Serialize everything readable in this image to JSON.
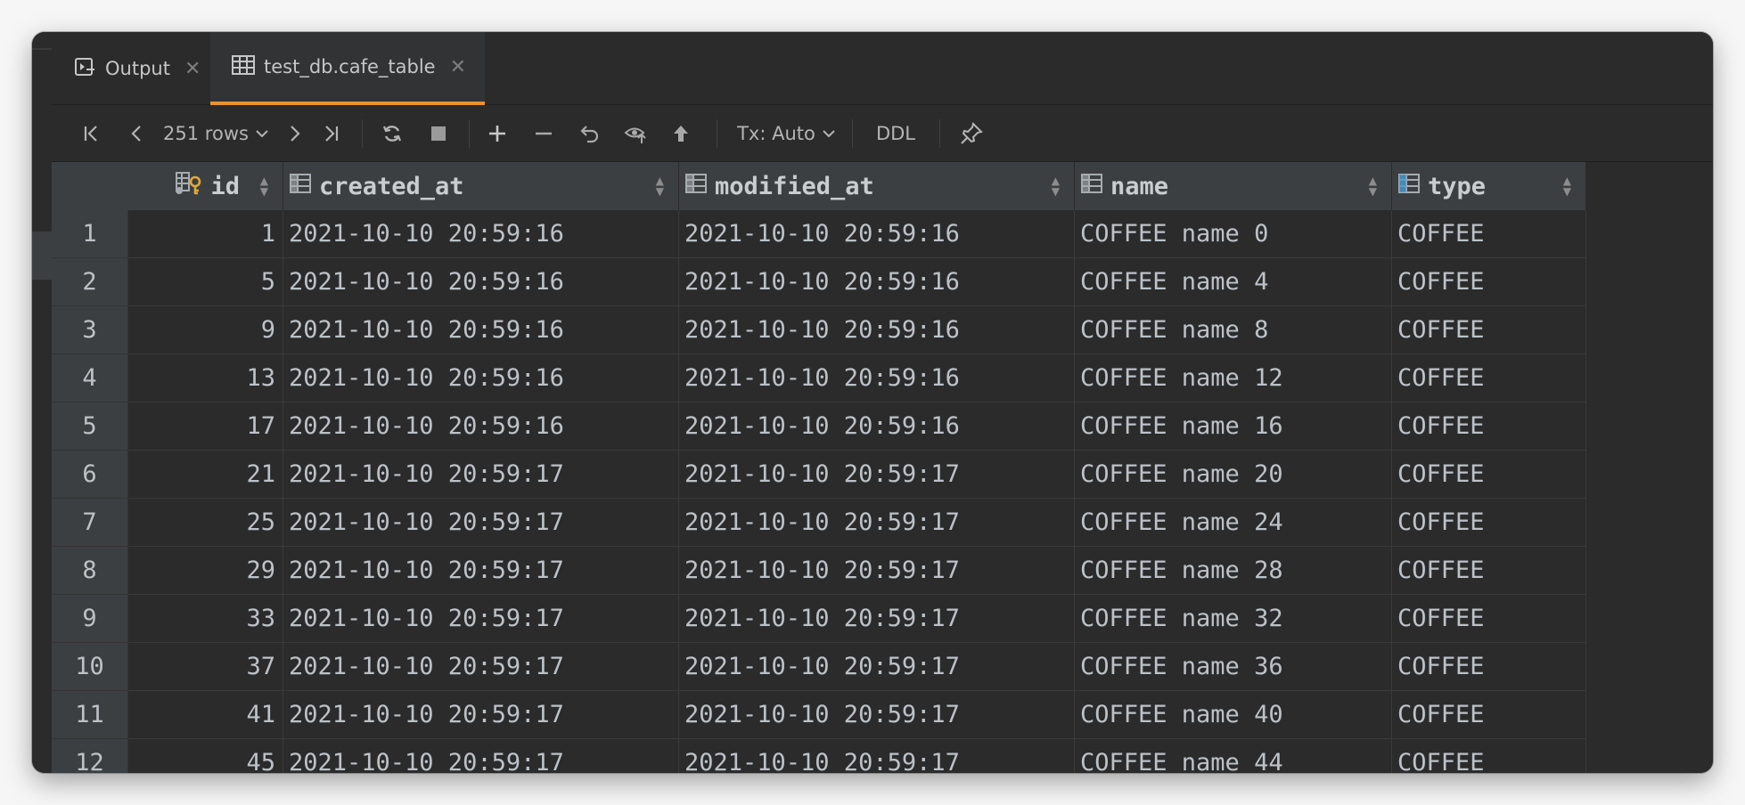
{
  "tabs": [
    {
      "label": "Output",
      "icon": "console-icon",
      "active": false
    },
    {
      "label": "test_db.cafe_table",
      "icon": "table-icon",
      "active": true
    }
  ],
  "toolbar": {
    "rows_label": "251 rows",
    "tx_label": "Tx: Auto",
    "ddl_label": "DDL"
  },
  "columns": [
    {
      "name": "id",
      "icon": "primary-key-column-icon"
    },
    {
      "name": "created_at",
      "icon": "column-icon"
    },
    {
      "name": "modified_at",
      "icon": "column-icon"
    },
    {
      "name": "name",
      "icon": "column-icon"
    },
    {
      "name": "type",
      "icon": "column-icon"
    }
  ],
  "rows": [
    {
      "n": "1",
      "id": "1",
      "created_at": "2021-10-10 20:59:16",
      "modified_at": "2021-10-10 20:59:16",
      "name": "COFFEE name 0",
      "type": "COFFEE"
    },
    {
      "n": "2",
      "id": "5",
      "created_at": "2021-10-10 20:59:16",
      "modified_at": "2021-10-10 20:59:16",
      "name": "COFFEE name 4",
      "type": "COFFEE"
    },
    {
      "n": "3",
      "id": "9",
      "created_at": "2021-10-10 20:59:16",
      "modified_at": "2021-10-10 20:59:16",
      "name": "COFFEE name 8",
      "type": "COFFEE"
    },
    {
      "n": "4",
      "id": "13",
      "created_at": "2021-10-10 20:59:16",
      "modified_at": "2021-10-10 20:59:16",
      "name": "COFFEE name 12",
      "type": "COFFEE"
    },
    {
      "n": "5",
      "id": "17",
      "created_at": "2021-10-10 20:59:16",
      "modified_at": "2021-10-10 20:59:16",
      "name": "COFFEE name 16",
      "type": "COFFEE"
    },
    {
      "n": "6",
      "id": "21",
      "created_at": "2021-10-10 20:59:17",
      "modified_at": "2021-10-10 20:59:17",
      "name": "COFFEE name 20",
      "type": "COFFEE"
    },
    {
      "n": "7",
      "id": "25",
      "created_at": "2021-10-10 20:59:17",
      "modified_at": "2021-10-10 20:59:17",
      "name": "COFFEE name 24",
      "type": "COFFEE"
    },
    {
      "n": "8",
      "id": "29",
      "created_at": "2021-10-10 20:59:17",
      "modified_at": "2021-10-10 20:59:17",
      "name": "COFFEE name 28",
      "type": "COFFEE"
    },
    {
      "n": "9",
      "id": "33",
      "created_at": "2021-10-10 20:59:17",
      "modified_at": "2021-10-10 20:59:17",
      "name": "COFFEE name 32",
      "type": "COFFEE"
    },
    {
      "n": "10",
      "id": "37",
      "created_at": "2021-10-10 20:59:17",
      "modified_at": "2021-10-10 20:59:17",
      "name": "COFFEE name 36",
      "type": "COFFEE"
    },
    {
      "n": "11",
      "id": "41",
      "created_at": "2021-10-10 20:59:17",
      "modified_at": "2021-10-10 20:59:17",
      "name": "COFFEE name 40",
      "type": "COFFEE"
    },
    {
      "n": "12",
      "id": "45",
      "created_at": "2021-10-10 20:59:17",
      "modified_at": "2021-10-10 20:59:17",
      "name": "COFFEE name 44",
      "type": "COFFEE"
    }
  ],
  "colors": {
    "background": "#2b2b2b",
    "header": "#3c3f41",
    "active_tab_underline": "#e8932c",
    "text": "#bcc2c7",
    "pk_key": "#e0a93a"
  }
}
